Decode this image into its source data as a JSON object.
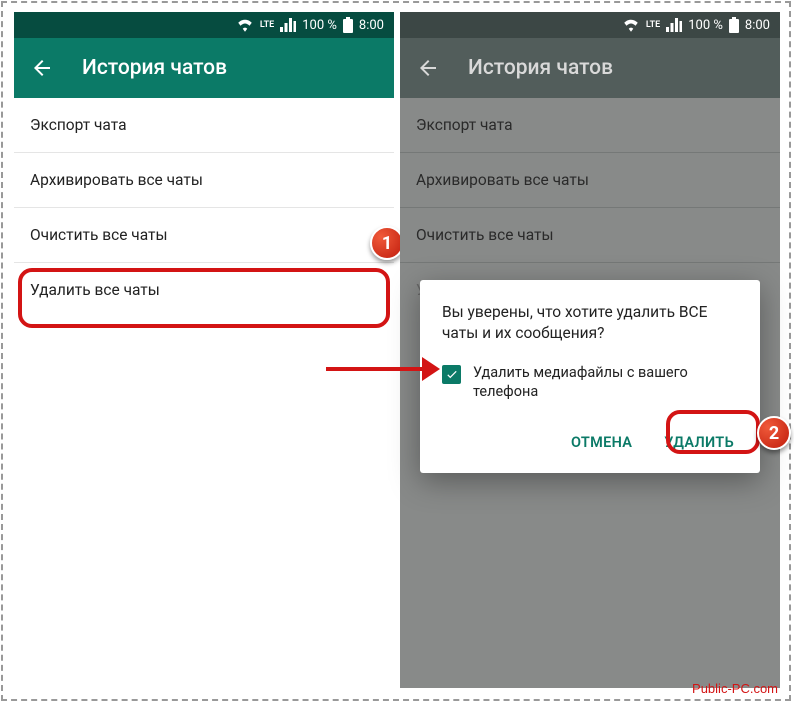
{
  "status": {
    "battery": "100 %",
    "time": "8:00",
    "lte": "LTE"
  },
  "header": {
    "title": "История чатов"
  },
  "menu": {
    "export": "Экспорт чата",
    "archive": "Архивировать все чаты",
    "clear": "Очистить все чаты",
    "delete": "Удалить все чаты"
  },
  "dialog": {
    "message": "Вы уверены, что хотите удалить ВСЕ чаты и их сообщения?",
    "checkbox_label": "Удалить медиафайлы с вашего телефона",
    "cancel": "ОТМЕНА",
    "confirm": "УДАЛИТЬ"
  },
  "markers": {
    "one": "1",
    "two": "2"
  },
  "watermark": "Public-PC.com"
}
